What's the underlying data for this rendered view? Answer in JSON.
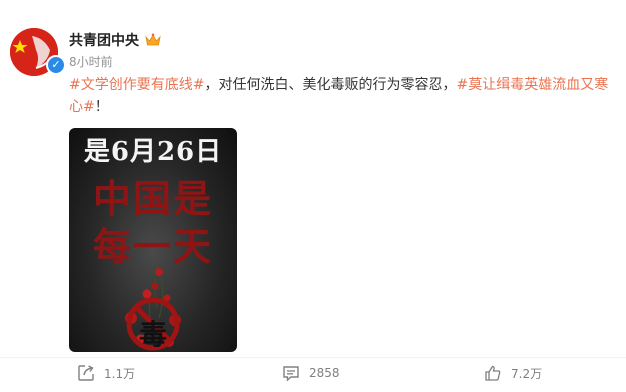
{
  "post": {
    "author": "共青团中央",
    "time": "8小时前",
    "content": {
      "topic1": "#文学创作要有底线#",
      "text": "，对任何洗白、美化毒贩的行为零容忍，",
      "topic2": "#莫让缉毒英雄流血又寒心#",
      "tail": "！"
    }
  },
  "poster": {
    "line1": "是6月26日",
    "line2": "中国是",
    "line3": "每一天",
    "stamp": "毒"
  },
  "actions": {
    "repost": "1.1万",
    "comments": "2858",
    "likes": "7.2万"
  },
  "icons": {
    "verified": "verified-badge-icon",
    "crown": "crown-icon",
    "repost": "repost-icon",
    "comment": "comment-icon",
    "like": "thumbs-up-icon"
  },
  "colors": {
    "topic": "#eb7350",
    "avatar": "#d7231a",
    "verified": "#2b8ae6",
    "poster_red": "#8f1515"
  }
}
